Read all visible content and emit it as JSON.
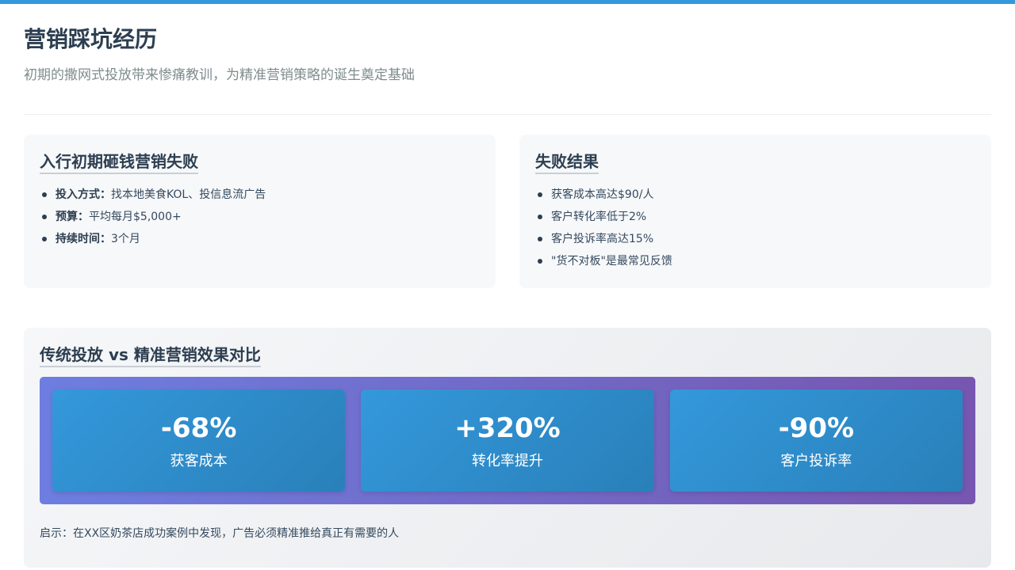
{
  "header": {
    "title": "营销踩坑经历",
    "subtitle": "初期的撒网式投放带来惨痛教训，为精准营销策略的诞生奠定基础"
  },
  "left_card": {
    "title": "入行初期砸钱营销失败",
    "items": [
      {
        "key": "投入方式：",
        "value": "找本地美食KOL、投信息流广告"
      },
      {
        "key": "预算：",
        "value": "平均每月$5,000+"
      },
      {
        "key": "持续时间：",
        "value": "3个月"
      }
    ]
  },
  "right_card": {
    "title": "失败结果",
    "items": [
      "获客成本高达$90/人",
      "客户转化率低于2%",
      "客户投诉率高达15%",
      "\"货不对板\"是最常见反馈"
    ]
  },
  "comparison": {
    "title": "传统投放 vs 精准营销效果对比",
    "stats": [
      {
        "value": "-68%",
        "label": "获客成本"
      },
      {
        "value": "+320%",
        "label": "转化率提升"
      },
      {
        "value": "-90%",
        "label": "客户投诉率"
      }
    ],
    "insight": "启示：在XX区奶茶店成功案例中发现，广告必须精准推给真正有需要的人"
  },
  "colors": {
    "accent": "#3498db",
    "band_start": "#6d7ee0",
    "band_end": "#7656b0",
    "stat_card": "#3498db"
  }
}
